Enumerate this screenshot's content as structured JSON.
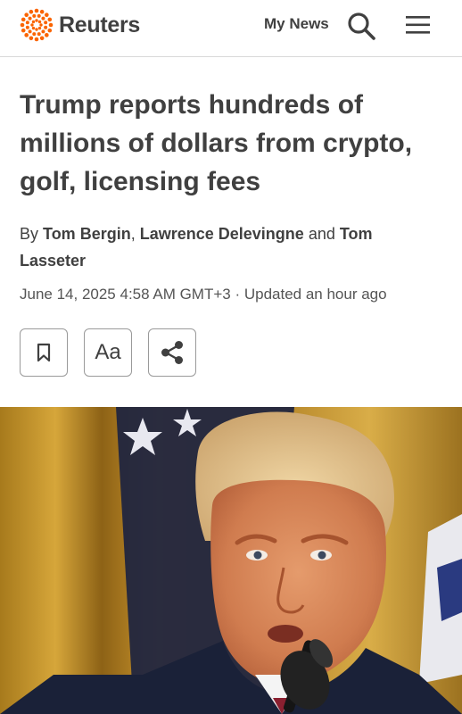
{
  "header": {
    "logo_text": "Reuters",
    "logo_icon": "reuters-dot-ring-icon",
    "my_news_label": "My News",
    "search_icon": "search-icon",
    "menu_icon": "hamburger-menu-icon",
    "brand_color": "#fa6400"
  },
  "article": {
    "headline": "Trump reports hundreds of millions of dollars from crypto, golf, licensing fees",
    "byline_prefix": "By",
    "authors": [
      "Tom Bergin",
      "Lawrence Delevingne",
      "Tom Lasseter"
    ],
    "separator_comma": ",",
    "separator_and": "and",
    "dateline": "June 14, 2025 4:58 AM GMT+3 · Updated an hour ago",
    "actions": [
      {
        "icon": "bookmark-icon"
      },
      {
        "label": "Aa",
        "icon": "text-size-icon"
      },
      {
        "icon": "share-icon"
      }
    ]
  }
}
